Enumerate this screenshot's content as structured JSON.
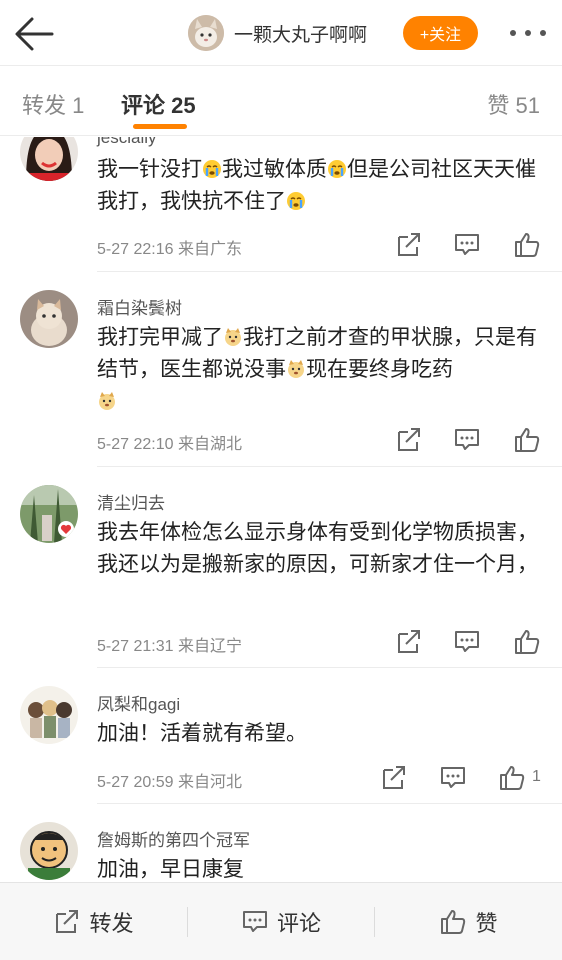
{
  "header": {
    "author_name": "一颗大丸子啊啊",
    "follow_label": "+关注"
  },
  "tabs": {
    "repost": "转发 1",
    "comment": "评论 25",
    "like": "赞 51"
  },
  "comments": [
    {
      "name": "jescialiy",
      "text_parts": [
        "我一针没打",
        "我过敏体质",
        "但是公司社区天天催我打，我快抗不住了"
      ],
      "time": "5-27 22:16",
      "location": "来自广东"
    },
    {
      "name": "霜白染鬓树",
      "text_parts": [
        "我打完甲减了",
        "我打之前才查的甲状腺，只是有结节，医生都说没事",
        "现在要终身吃药"
      ],
      "time": "5-27 22:10",
      "location": "来自湖北"
    },
    {
      "name": "清尘归去",
      "text": "我去年体检怎么显示身体有受到化学物质损害，我还以为是搬新家的原因，可新家才住一个月，",
      "time": "5-27 21:31",
      "location": "来自辽宁"
    },
    {
      "name": "凤梨和gagi",
      "text": "加油！活着就有希望。",
      "time": "5-27 20:59",
      "location": "来自河北",
      "like_count": "1"
    },
    {
      "name": "詹姆斯的第四个冠军",
      "text": "加油，早日康复"
    }
  ],
  "bottombar": {
    "repost": "转发",
    "comment": "评论",
    "like": "赞"
  },
  "colors": {
    "accent": "#ff8200",
    "text": "#222222",
    "meta": "#888888"
  }
}
